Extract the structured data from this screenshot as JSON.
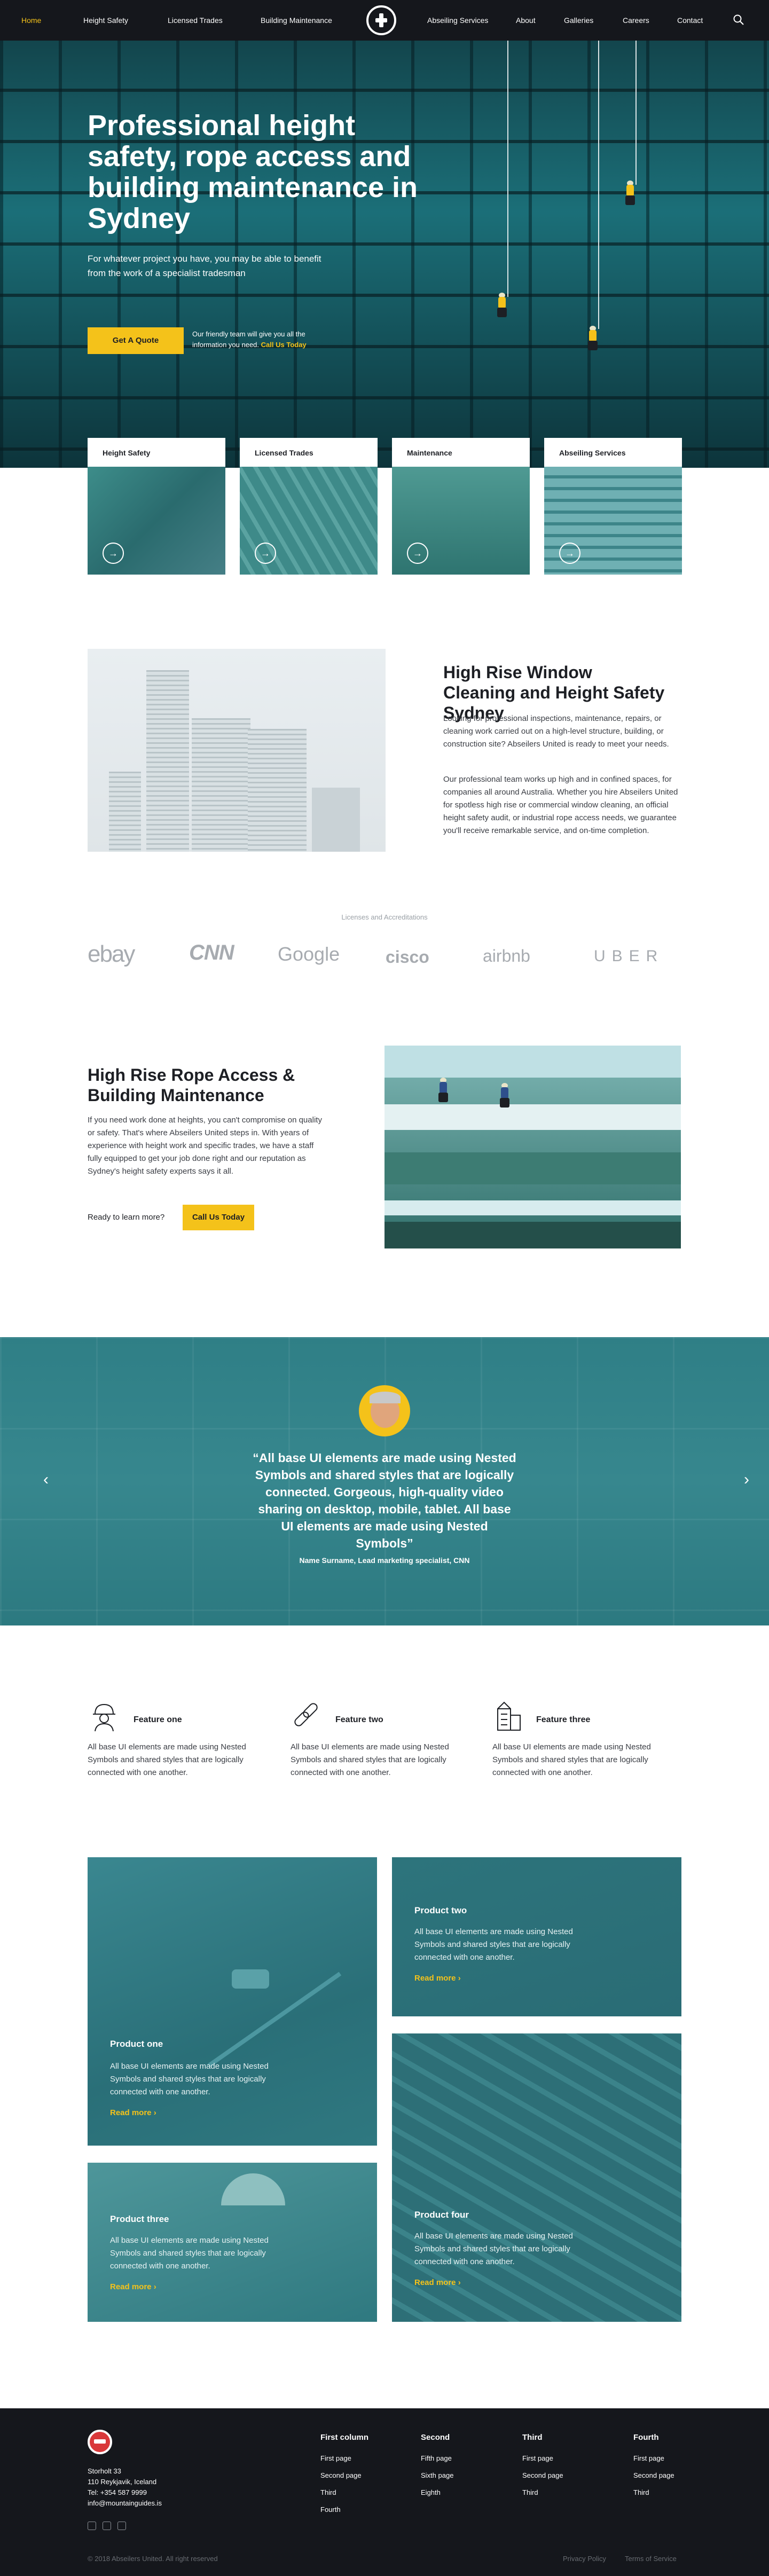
{
  "nav": {
    "items": [
      "Home",
      "Height Safety",
      "Licensed Trades",
      "Building Maintenance",
      "Abseiling Services",
      "About",
      "Galleries",
      "Careers",
      "Contact"
    ],
    "active": "Home",
    "logo_icon": "cross-shield-icon",
    "search_icon": "search-icon"
  },
  "hero": {
    "title": "Professional height safety, rope access and building maintenance in Sydney",
    "lead": "For whatever project you have, you may be able to benefit from the work of a specialist tradesman",
    "cta": "Get A Quote",
    "note": "Our friendly team will give you all the information you need.",
    "note_link": "Call Us Today"
  },
  "services": [
    {
      "label": "Height Safety",
      "arrow_icon": "arrow-right-icon"
    },
    {
      "label": "Licensed Trades",
      "arrow_icon": "arrow-right-icon"
    },
    {
      "label": "Maintenance",
      "arrow_icon": "arrow-right-icon"
    },
    {
      "label": "Abseiling Services",
      "arrow_icon": "arrow-right-icon"
    }
  ],
  "window_cleaning": {
    "title": "High Rise Window Cleaning and Height Safety Sydney",
    "p1": "Looking for professional inspections, maintenance, repairs, or cleaning work carried out on a high-level structure, building, or construction site? Abseilers United is ready to meet your needs.",
    "p2": "Our professional team works up high and in confined spaces, for companies all around Australia. Whether you hire Abseilers United for spotless high rise or commercial window cleaning, an official height safety audit, or industrial rope access needs, we guarantee you'll receive remarkable service, and on-time completion."
  },
  "logos": {
    "title": "Licenses and Accreditations",
    "items": [
      "ebay",
      "CNN",
      "Google",
      "cisco",
      "airbnb",
      "UBER"
    ]
  },
  "rope_access": {
    "title": "High Rise Rope Access & Building Maintenance",
    "text": "If you need work done at heights, you can't compromise on quality or safety. That's where Abseilers United steps in. With years of experience with height work and specific trades, we have a staff fully equipped to get your job done right and our reputation as Sydney's height safety experts says it all.",
    "ready": "Ready to learn more?",
    "cta": "Call Us Today"
  },
  "testimonial": {
    "quote": "“All base UI elements are made using Nested Symbols and shared styles that are logically connected. Gorgeous, high-quality video sharing on desktop, mobile, tablet. All base UI elements are made using Nested Symbols”",
    "author": "Name Surname, Lead marketing specialist, CNN",
    "prev_icon": "chevron-left-icon",
    "next_icon": "chevron-right-icon"
  },
  "features": [
    {
      "title": "Feature one",
      "text": "All base UI elements are made using Nested Symbols and shared styles that are logically connected with one another.",
      "icon": "worker-icon"
    },
    {
      "title": "Feature two",
      "text": "All base UI elements are made using Nested Symbols and shared styles that are logically connected with one another.",
      "icon": "chain-icon"
    },
    {
      "title": "Feature three",
      "text": "All base UI elements are made using Nested Symbols and shared styles that are logically connected with one another.",
      "icon": "building-icon"
    }
  ],
  "products": [
    {
      "title": "Product one",
      "text": "All base UI elements are made using Nested Symbols and shared styles that are logically connected with one another.",
      "more": "Read more"
    },
    {
      "title": "Product two",
      "text": "All base UI elements are made using Nested Symbols and shared styles that are logically connected with one another.",
      "more": "Read more"
    },
    {
      "title": "Product three",
      "text": "All base UI elements are made using Nested Symbols and shared styles that are logically connected with one another.",
      "more": "Read more"
    },
    {
      "title": "Product four",
      "text": "All base UI elements are made using Nested Symbols and shared styles that are logically connected with one another.",
      "more": "Read more"
    }
  ],
  "footer": {
    "address": [
      "Storholt 33",
      "110 Reykjavik, Iceland",
      "Tel: +354 587 9999",
      "info@mountainguides.is"
    ],
    "social_icons": [
      "twitter-icon",
      "facebook-icon",
      "linkedin-icon"
    ],
    "columns": [
      {
        "title": "First column",
        "links": [
          "First page",
          "Second page",
          "Third",
          "Fourth"
        ]
      },
      {
        "title": "Second",
        "links": [
          "Fifth page",
          "Sixth page",
          "Eighth"
        ]
      },
      {
        "title": "Third",
        "links": [
          "First page",
          "Second page",
          "Third"
        ]
      },
      {
        "title": "Fourth",
        "links": [
          "First page",
          "Second page",
          "Third"
        ]
      }
    ],
    "copyright": "© 2018 Abseilers United. All right reserved",
    "privacy": "Privacy Policy",
    "terms": "Terms of Service"
  },
  "colors": {
    "accent": "#f4c21a",
    "teal": "#2f7f86",
    "dark": "#15171c"
  }
}
